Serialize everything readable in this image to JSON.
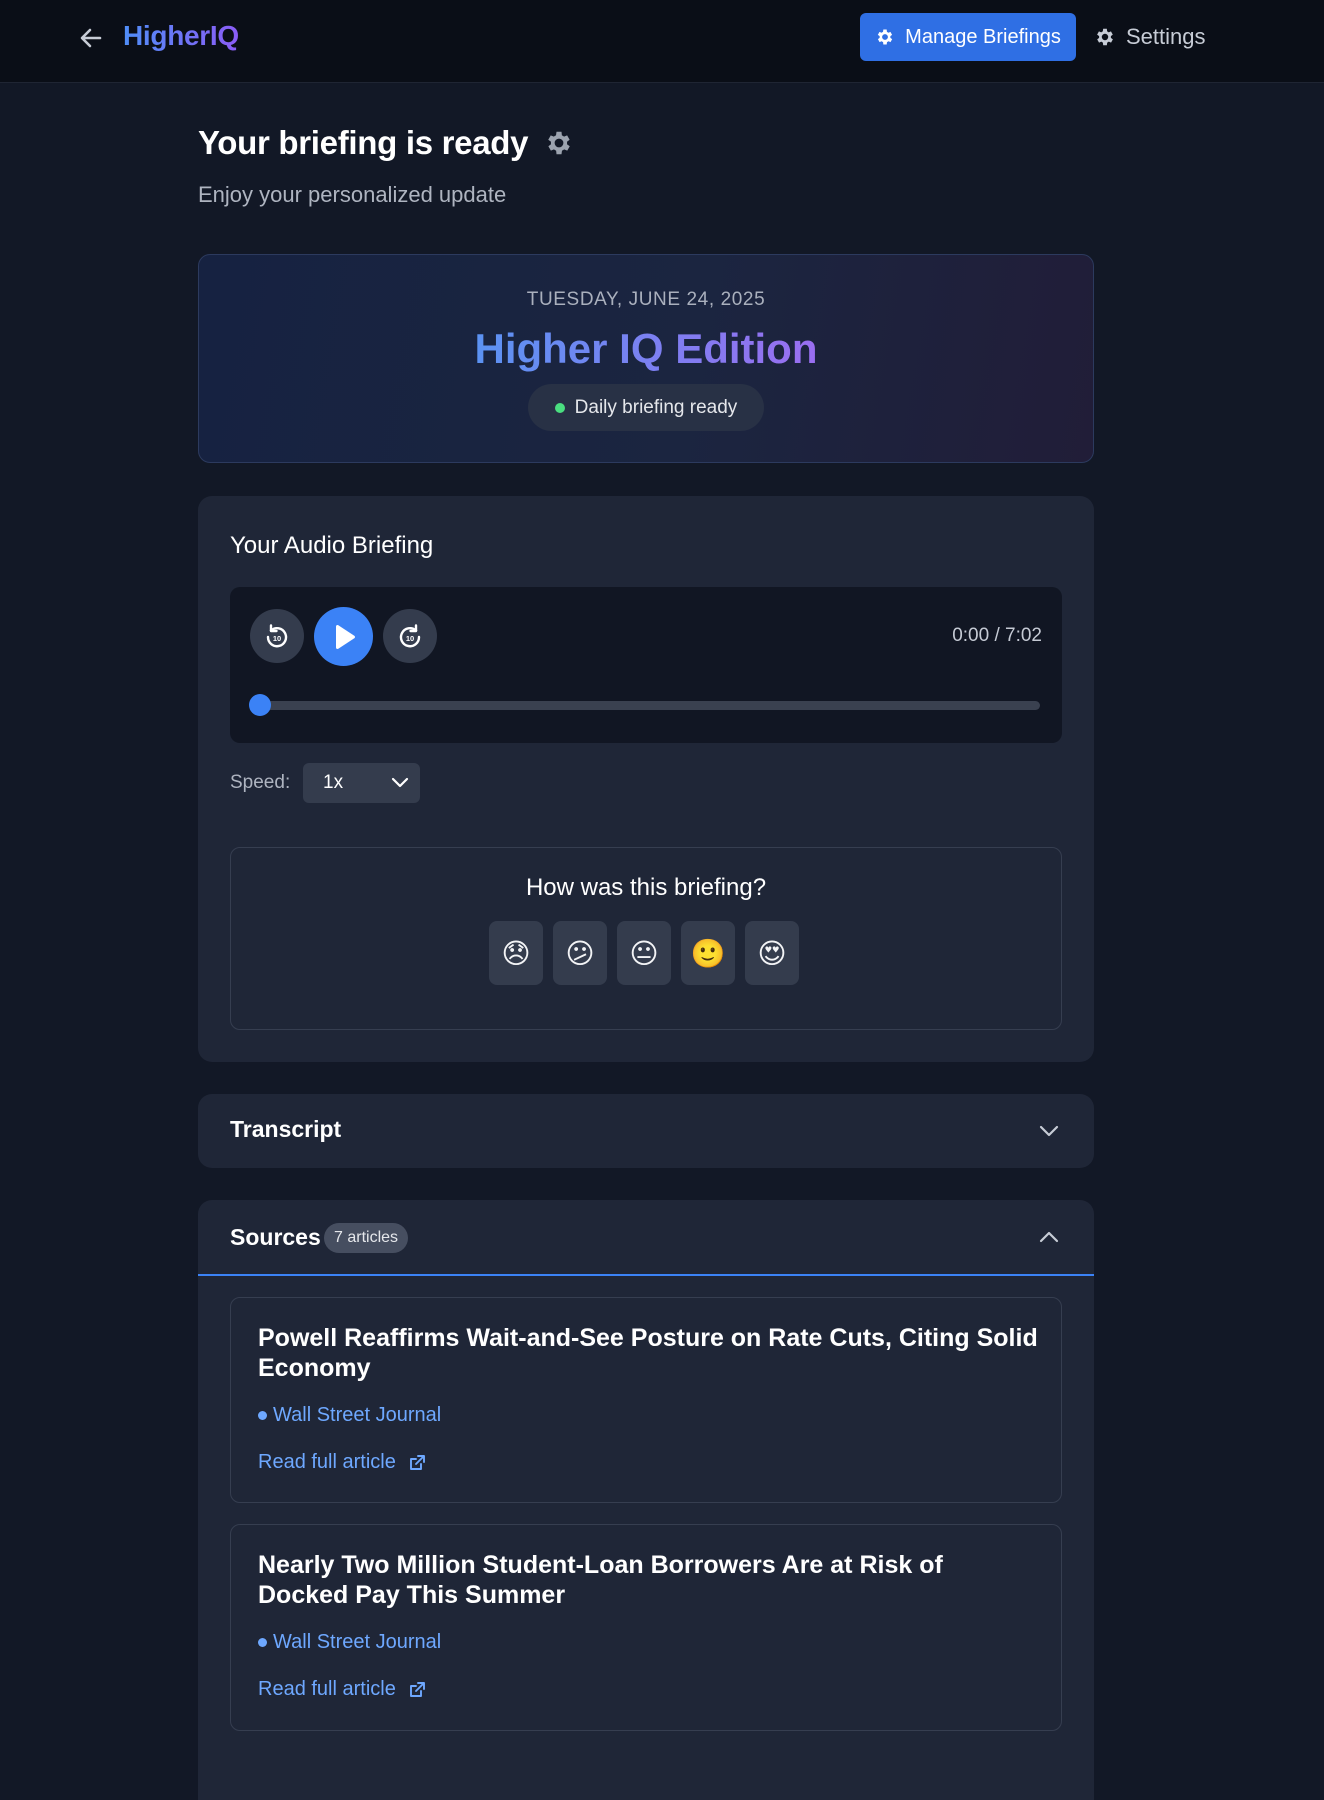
{
  "header": {
    "brand": "HigherIQ",
    "manage_label": "Manage Briefings",
    "settings_label": "Settings"
  },
  "page": {
    "title": "Your briefing is ready",
    "subtitle": "Enjoy your personalized update"
  },
  "edition": {
    "date": "TUESDAY, JUNE 24, 2025",
    "title": "Higher IQ Edition",
    "status": "Daily briefing ready"
  },
  "audio": {
    "title": "Your Audio Briefing",
    "time": "0:00 / 7:02",
    "progress": 0,
    "speed_label": "Speed:",
    "speed_value": "1x",
    "feedback_question": "How was this briefing?",
    "ratings": [
      "😞",
      "😕",
      "😐",
      "🙂",
      "😍"
    ]
  },
  "transcript": {
    "title": "Transcript"
  },
  "sources": {
    "title": "Sources",
    "count": "7 articles",
    "articles": [
      {
        "title": "Powell Reaffirms Wait-and-See Posture on Rate Cuts, Citing Solid Economy",
        "source": "Wall Street Journal",
        "link": "Read full article"
      },
      {
        "title": "Nearly Two Million Student-Loan Borrowers Are at Risk of Docked Pay This Summer",
        "source": "Wall Street Journal",
        "link": "Read full article"
      }
    ]
  },
  "colors": {
    "accent": "#3b82f6",
    "brand_start": "#4f8ef7",
    "brand_end": "#8b5cf6",
    "status_green": "#4ade80",
    "link": "#6ea8ff"
  }
}
